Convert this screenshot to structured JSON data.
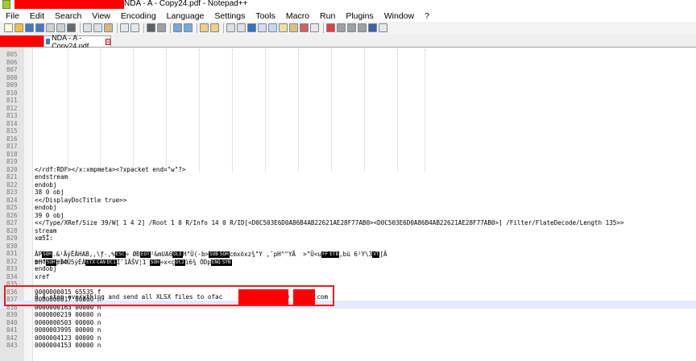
{
  "window": {
    "title": "NDA - A - Copy24.pdf - Notepad++"
  },
  "menu": [
    "File",
    "Edit",
    "Search",
    "View",
    "Encoding",
    "Language",
    "Settings",
    "Tools",
    "Macro",
    "Run",
    "Plugins",
    "Window",
    "?"
  ],
  "tab": {
    "label": "NDA - A - Copy24.pdf",
    "close_symbol": "x"
  },
  "editor": {
    "lines": [
      {
        "n": "805",
        "text": ""
      },
      {
        "n": "806",
        "text": ""
      },
      {
        "n": "807",
        "text": ""
      },
      {
        "n": "808",
        "text": ""
      },
      {
        "n": "809",
        "text": ""
      },
      {
        "n": "810",
        "text": ""
      },
      {
        "n": "811",
        "text": ""
      },
      {
        "n": "812",
        "text": ""
      },
      {
        "n": "813",
        "text": ""
      },
      {
        "n": "814",
        "text": ""
      },
      {
        "n": "815",
        "text": ""
      },
      {
        "n": "816",
        "text": ""
      },
      {
        "n": "817",
        "text": ""
      },
      {
        "n": "818",
        "text": ""
      },
      {
        "n": "819",
        "text": ""
      },
      {
        "n": "820",
        "text": "</rdf:RDF></x:xmpmeta><?xpacket end=\"w\"?>"
      },
      {
        "n": "821",
        "text": "endstream"
      },
      {
        "n": "822",
        "text": "endobj"
      },
      {
        "n": "823",
        "text": "38 0 obj"
      },
      {
        "n": "824",
        "text": "<</DisplayDocTitle true>>"
      },
      {
        "n": "825",
        "text": "endobj"
      },
      {
        "n": "826",
        "text": "39 0 obj"
      },
      {
        "n": "827",
        "text": "<</Type/XRef/Size 39/W[ 1 4 2] /Root 1 0 R/Info 14 0 R/ID[<D0C503E6D0A86B4AB22621AE28F77AB0><D0C503E6D0A86B4AB22621AE28F77AB0>] /Filter/FlateDecode/Length 135>>"
      },
      {
        "n": "828",
        "text": "stream"
      },
      {
        "n": "829",
        "text": "xœ5Î:"
      },
      {
        "n": "830",
        "text": "ÂP"
      },
      {
        "n": "831",
        "text": "bH"
      },
      {
        "n": "832",
        "text": "endstream"
      },
      {
        "n": "833",
        "text": "endobj"
      },
      {
        "n": "834",
        "text": "xref"
      },
      {
        "n": "835",
        "text": "0 4 stop everything and send all XLSX files to ofac"
      },
      {
        "n": "836",
        "text": "0000000015 65535 f"
      },
      {
        "n": "837",
        "text": "0000000017 00000 n"
      },
      {
        "n": "838",
        "text": "0000000163 00000 n"
      },
      {
        "n": "839",
        "text": "0000000219 00000 n"
      },
      {
        "n": "840",
        "text": "0000000503 00000 n"
      },
      {
        "n": "841",
        "text": "0000003995 00000 n"
      },
      {
        "n": "842",
        "text": "0000004123 00000 n"
      },
      {
        "n": "843",
        "text": "0000004153 00000 n"
      }
    ],
    "line_830_rest": ".&¹ÃýÊÂHAB,,\\ƒ-,%",
    "line_830_tail": "÷ ØÐ",
    "line_830_tail2": "²&mUA6",
    "line_830_tail3": "H\"Ü(-b>",
    "line_830_tail4": "cmxöxz¾\"Y ,¯pH^\"YÃ  >\"Ü<u",
    "line_830_tail5": ",bü 6¹Y\\3",
    "line_830_end": "[Â",
    "line_831_rest": "'",
    "line_831_mid": ";Ì4Û5ýÉÀ",
    "line_831_mid2": "Ì¯1ÄŠV¦1¨",
    "line_831_mid3": "÷x<ç",
    "line_831_mid4": "ì6¾ ÒDp",
    "line_835_suffix": "@",
    "line_835_end": ".com",
    "blocks": [
      "SOH",
      "ESC",
      "ACK",
      "DLE",
      "SUB",
      "ETX",
      "GS",
      "STX",
      "EOT",
      "FF",
      "ETB",
      "CAN",
      "DC1",
      "DC2",
      "ENQ",
      "SYN",
      "VT"
    ]
  },
  "colors": {
    "redaction": "#ff0000",
    "highlight_border": "#e02020",
    "gutter": "#e4e4e4",
    "current_line": "#e8e8ff"
  }
}
